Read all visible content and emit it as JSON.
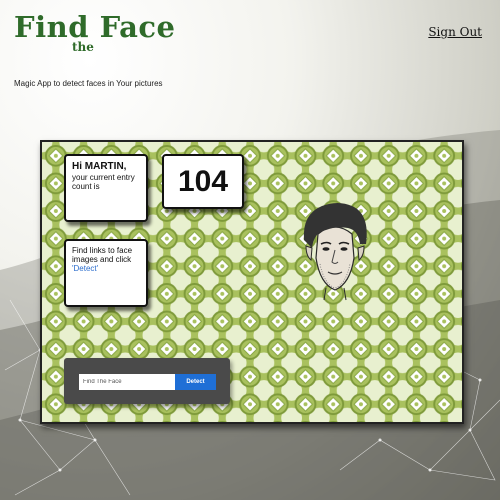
{
  "header": {
    "logo_main": "Find Face",
    "logo_small": "the",
    "sign_out_label": "Sign Out",
    "tagline": "Magic App to detect faces in Your pictures"
  },
  "greeting": {
    "hello": "Hi ",
    "name": "MARTIN",
    "punct": ",",
    "message": "your current entry count is"
  },
  "entry_count": "104",
  "instructions": {
    "text": "Find links to face images and click ",
    "action": "'Detect'"
  },
  "search": {
    "placeholder": "Find The Face",
    "value": "",
    "button_label": "Detect"
  },
  "colors": {
    "brand_green": "#2f6b2a",
    "pattern_green": "#a9c15e",
    "button_blue": "#1f6fd6"
  },
  "icons": {
    "avatar": "face-logo-icon"
  }
}
